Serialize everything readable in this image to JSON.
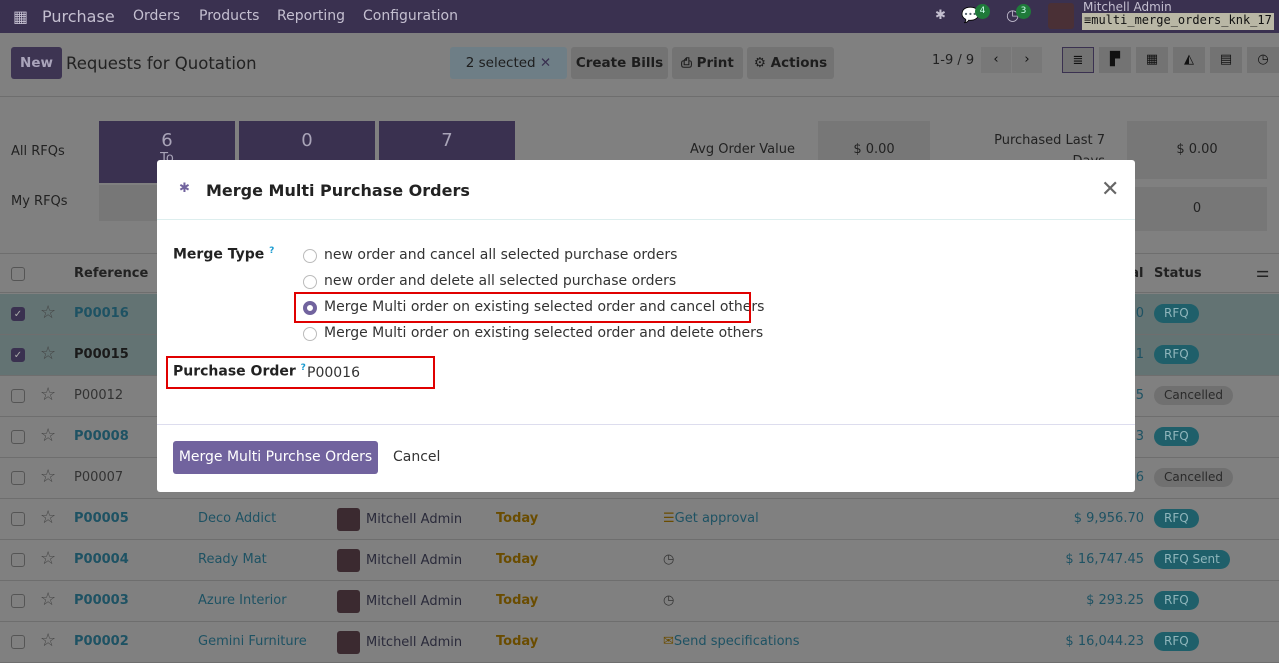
{
  "navbar": {
    "app": "Purchase",
    "menu": [
      "Orders",
      "Products",
      "Reporting",
      "Configuration"
    ],
    "chat_count": "4",
    "activity_count": "3",
    "user": "Mitchell Admin",
    "database": "multi_merge_orders_knk_17"
  },
  "control": {
    "new_label": "New",
    "title": "Requests for Quotation",
    "selected": "2 selected",
    "create_bills": "Create Bills",
    "print": "Print",
    "actions": "Actions",
    "pager": "1-9 / 9"
  },
  "stats": {
    "all_rfqs": "All RFQs",
    "my_rfqs": "My RFQs",
    "tiles": [
      {
        "value": "6",
        "label": "To"
      },
      {
        "value": "0"
      },
      {
        "value": "7"
      }
    ],
    "avg_label": "Avg Order Value",
    "avg_value": "$ 0.00",
    "purchased_label": "Purchased Last 7 Days",
    "purchased_value": "$ 0.00",
    "my_value": "0"
  },
  "table": {
    "headers": {
      "reference": "Reference",
      "total": "Total",
      "status": "Status"
    },
    "rows": [
      {
        "ref": "P00016",
        "amount": "0",
        "status": "RFQ",
        "selected": true
      },
      {
        "ref": "P00015",
        "amount": "1",
        "status": "RFQ",
        "selected": true
      },
      {
        "ref": "P00012",
        "amount": "5",
        "status": "Cancelled"
      },
      {
        "ref": "P00008",
        "amount": "3",
        "status": "RFQ"
      },
      {
        "ref": "P00007",
        "amount": "6",
        "status": "Cancelled"
      },
      {
        "ref": "P00005",
        "vendor": "Deco Addict",
        "buyer": "Mitchell Admin",
        "deadline": "Today",
        "activity": "Get approval",
        "amount": "$ 9,956.70",
        "status": "RFQ"
      },
      {
        "ref": "P00004",
        "vendor": "Ready Mat",
        "buyer": "Mitchell Admin",
        "deadline": "Today",
        "activity": "",
        "amount": "$ 16,747.45",
        "status": "RFQ Sent"
      },
      {
        "ref": "P00003",
        "vendor": "Azure Interior",
        "buyer": "Mitchell Admin",
        "deadline": "Today",
        "activity": "",
        "amount": "$ 293.25",
        "status": "RFQ"
      },
      {
        "ref": "P00002",
        "vendor": "Gemini Furniture",
        "buyer": "Mitchell Admin",
        "deadline": "Today",
        "activity": "Send specifications",
        "amount": "$ 16,044.23",
        "status": "RFQ"
      }
    ]
  },
  "modal": {
    "title": "Merge Multi Purchase Orders",
    "merge_type_label": "Merge Type",
    "help": "?",
    "options": [
      "new order and cancel all selected purchase orders",
      "new order and delete all selected purchase orders",
      "Merge Multi order on existing selected order and cancel others",
      "Merge Multi order on existing selected order and delete others"
    ],
    "selected_option": 2,
    "purchase_order_label": "Purchase Order",
    "purchase_order_value": "P00016",
    "confirm": "Merge Multi Purchse Orders",
    "cancel": "Cancel"
  },
  "colors": {
    "brand": "#3a3150",
    "primary_button": "#71639e",
    "highlight": "#e00000"
  }
}
